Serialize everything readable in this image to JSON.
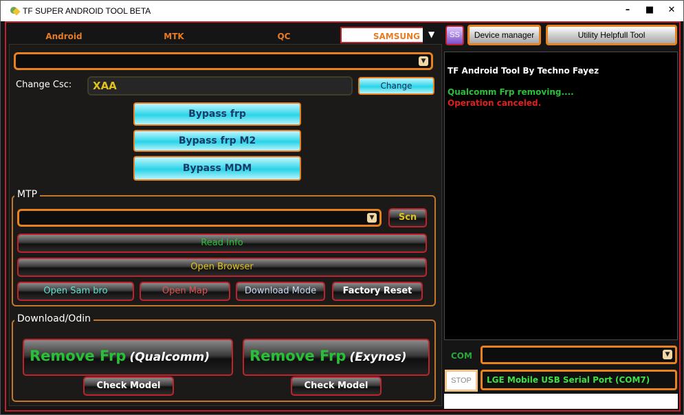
{
  "window": {
    "title": "TF SUPER ANDROID TOOL BETA",
    "controls": {
      "minimize": "–",
      "maximize": "■",
      "close": "✕"
    }
  },
  "tabs": [
    {
      "label": "Android"
    },
    {
      "label": "MTK"
    },
    {
      "label": "QC"
    },
    {
      "label": "SAMSUNG",
      "active": true
    }
  ],
  "tab_arrow": "▼",
  "samsung": {
    "change_csc_label": "Change Csc:",
    "csc_value": "XAA",
    "change_button": "Change",
    "bypass_frp": "Bypass frp",
    "bypass_frp_m2": "Bypass frp M2",
    "bypass_mdm": "Bypass MDM"
  },
  "mtp": {
    "title": "MTP",
    "scan_button": "Scn",
    "read_info": "Read Info",
    "open_browser": "Open Browser",
    "open_sam_bro": "Open Sam bro",
    "open_map": "Open Map",
    "download_mode": "Download Mode",
    "factory_reset": "Factory Reset"
  },
  "odin": {
    "title": "Download/Odin",
    "remove_frp": "Remove Frp",
    "qualcomm": "(Qualcomm)",
    "exynos": "(Exynos)",
    "check_model": "Check Model"
  },
  "header": {
    "ss_button": "SS",
    "device_manager": "Device manager",
    "utility": "Utility  Helpfull Tool"
  },
  "log": {
    "lines": [
      {
        "text": "TF Android Tool By Techno Fayez",
        "color": "#ffffff"
      },
      {
        "text": "Qualcomm Frp removing....",
        "color": "#27c037"
      },
      {
        "text": "Operation canceled.",
        "color": "#e0201c"
      }
    ]
  },
  "port": {
    "com_label": "COM",
    "stop_button": "STOP",
    "selected_port": "LGE Mobile USB Serial Port (COM7)"
  },
  "colors": {
    "accent_orange": "#e8821e",
    "accent_red": "#c0232b",
    "cyan": "#2ad4e8",
    "green_text": "#27c037",
    "yellow_text": "#e0c21c"
  }
}
